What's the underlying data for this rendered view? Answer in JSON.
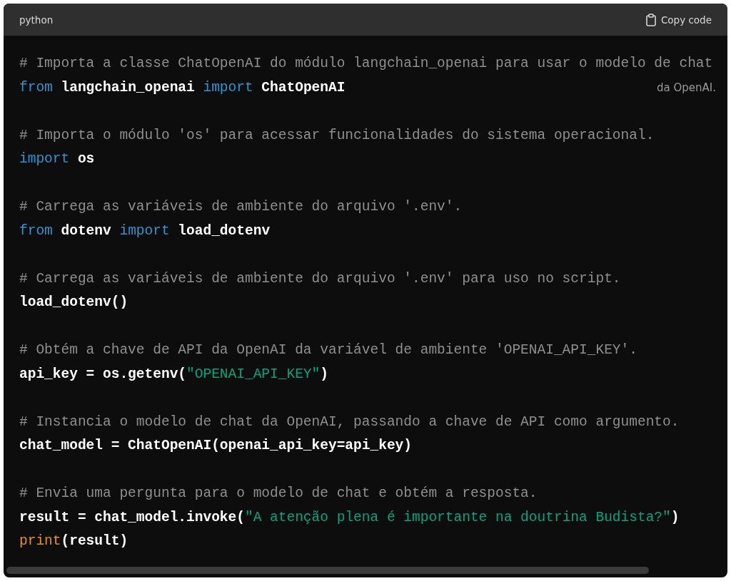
{
  "header": {
    "language": "python",
    "copy_label": "Copy code"
  },
  "blocks": [
    {
      "lines": [
        [
          {
            "kind": "comment",
            "text": "# Importa a classe ChatOpenAI do módulo langchain_openai para usar o modelo de chat"
          }
        ],
        [
          {
            "kind": "keyword",
            "text": "from"
          },
          {
            "kind": "plain",
            "text": " langchain_openai "
          },
          {
            "kind": "keyword",
            "text": "import"
          },
          {
            "kind": "plain",
            "text": " ChatOpenAI"
          }
        ]
      ],
      "wrapped_tail": "da OpenAI."
    },
    {
      "lines": [
        [
          {
            "kind": "comment",
            "text": "# Importa o módulo 'os' para acessar funcionalidades do sistema operacional."
          }
        ],
        [
          {
            "kind": "keyword",
            "text": "import"
          },
          {
            "kind": "plain",
            "text": " os"
          }
        ]
      ]
    },
    {
      "lines": [
        [
          {
            "kind": "comment",
            "text": "# Carrega as variáveis de ambiente do arquivo '.env'."
          }
        ],
        [
          {
            "kind": "keyword",
            "text": "from"
          },
          {
            "kind": "plain",
            "text": " dotenv "
          },
          {
            "kind": "keyword",
            "text": "import"
          },
          {
            "kind": "plain",
            "text": " load_dotenv"
          }
        ]
      ]
    },
    {
      "lines": [
        [
          {
            "kind": "comment",
            "text": "# Carrega as variáveis de ambiente do arquivo '.env' para uso no script."
          }
        ],
        [
          {
            "kind": "plain",
            "text": "load_dotenv()"
          }
        ]
      ]
    },
    {
      "lines": [
        [
          {
            "kind": "comment",
            "text": "# Obtém a chave de API da OpenAI da variável de ambiente 'OPENAI_API_KEY'."
          }
        ],
        [
          {
            "kind": "plain",
            "text": "api_key = os.getenv("
          },
          {
            "kind": "string",
            "text": "\"OPENAI_API_KEY\""
          },
          {
            "kind": "plain",
            "text": ")"
          }
        ]
      ]
    },
    {
      "lines": [
        [
          {
            "kind": "comment",
            "text": "# Instancia o modelo de chat da OpenAI, passando a chave de API como argumento."
          }
        ],
        [
          {
            "kind": "plain",
            "text": "chat_model = ChatOpenAI(openai_api_key=api_key)"
          }
        ]
      ]
    },
    {
      "lines": [
        [
          {
            "kind": "comment",
            "text": "# Envia uma pergunta para o modelo de chat e obtém a resposta."
          }
        ],
        [
          {
            "kind": "plain",
            "text": "result = chat_model.invoke("
          },
          {
            "kind": "string",
            "text": "\"A atenção plena é importante na doutrina Budista?\""
          },
          {
            "kind": "plain",
            "text": ")"
          }
        ],
        [
          {
            "kind": "builtin",
            "text": "print"
          },
          {
            "kind": "plain",
            "text": "(result)"
          }
        ]
      ]
    }
  ]
}
